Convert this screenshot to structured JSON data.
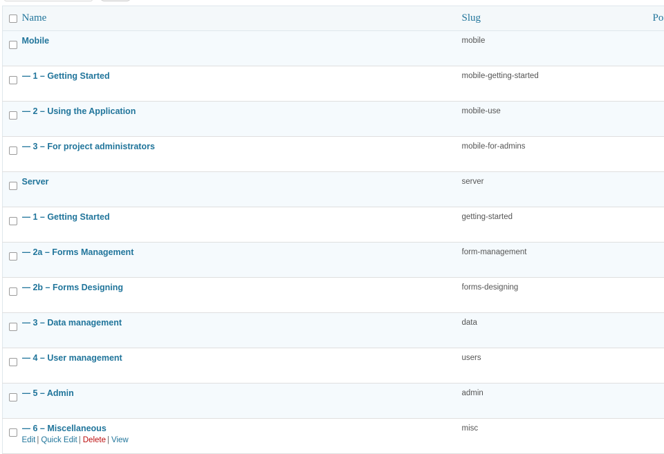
{
  "columns": {
    "name": "Name",
    "slug": "Slug",
    "pos": "Po"
  },
  "rows": [
    {
      "name": "Mobile",
      "slug": "mobile"
    },
    {
      "name": "— 1 – Getting Started",
      "slug": "mobile-getting-started"
    },
    {
      "name": "— 2 – Using the Application",
      "slug": "mobile-use"
    },
    {
      "name": "— 3 – For project administrators",
      "slug": "mobile-for-admins"
    },
    {
      "name": "Server",
      "slug": "server"
    },
    {
      "name": "— 1 – Getting Started",
      "slug": "getting-started"
    },
    {
      "name": "— 2a – Forms Management",
      "slug": "form-management"
    },
    {
      "name": "— 2b – Forms Designing",
      "slug": "forms-designing"
    },
    {
      "name": "— 3 – Data management",
      "slug": "data"
    },
    {
      "name": "— 4 – User management",
      "slug": "users"
    },
    {
      "name": "— 5 – Admin",
      "slug": "admin"
    },
    {
      "name": "— 6 – Miscellaneous",
      "slug": "misc"
    }
  ],
  "row_actions": {
    "edit": "Edit",
    "quick_edit": "Quick Edit",
    "delete": "Delete",
    "view": "View",
    "separator": "|"
  },
  "colors": {
    "link": "#21759b",
    "delete": "#bc0b0b",
    "header_bg": "#f4f8fa",
    "alt_row_bg": "#f5fafd"
  }
}
